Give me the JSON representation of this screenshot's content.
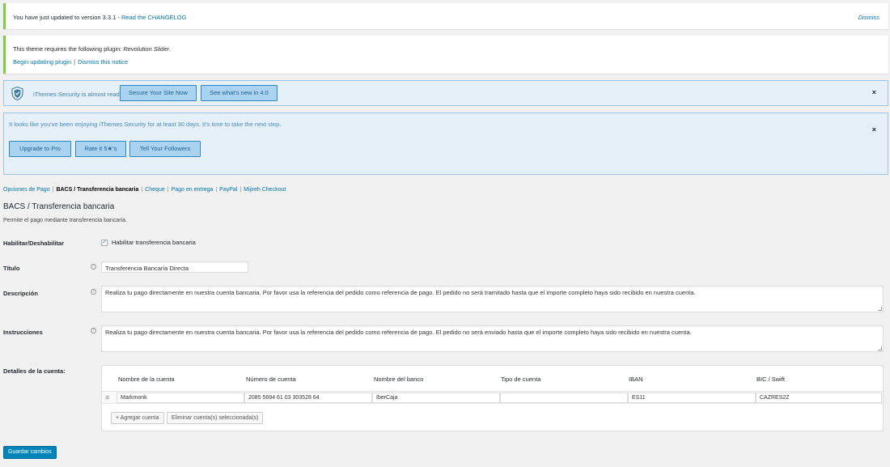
{
  "notice_update": {
    "message": "You have just updated to version 3.3.1 - ",
    "link": "Read the CHANGELOG",
    "dismiss": "Dismiss"
  },
  "notice_plugin": {
    "message_prefix": "This theme requires the following plugin: ",
    "plugin_name": "Revolution Slider",
    "message_suffix": ".",
    "begin_link": "Begin updating plugin",
    "separator": "|",
    "dismiss_link": "Dismiss this notice"
  },
  "ithemes_ready": {
    "message": "iThemes Security is almost ready.",
    "secure_button": "Secure Your Site Now",
    "whats_new_button": "See what's new in 4.0",
    "close": "×"
  },
  "ithemes_enjoy": {
    "message": "It looks like you've been enjoying iThemes Security for at least 30 days. It's time to take the next step.",
    "upgrade_button": "Upgrade to Pro",
    "rate_button": "Rate it 5★'s",
    "followers_button": "Tell Your Followers",
    "close": "×"
  },
  "subnav": {
    "items": [
      "Opciones de Pago",
      "BACS / Transferencia bancaria",
      "Cheque",
      "Pago en entrega",
      "PayPal",
      "Mijireh Checkout"
    ],
    "separator": "|"
  },
  "section": {
    "title": "BACS / Transferencia bancaria",
    "description": "Permite el pago mediante transferencia bancaria."
  },
  "form": {
    "enable_label": "Habilitar/Deshabilitar",
    "enable_checkbox_label": "Habilitar transferencia bancaria",
    "enable_checked": "✓",
    "title_label": "Título",
    "title_value": "Transferencia Bancaria Directa",
    "description_label": "Descripción",
    "description_value": "Realiza tu pago directamente en nuestra cuenta bancaria. Por favor usa la referencia del pedido como referencia de pago. El pedido no será tramitado hasta que el importe completo haya sido recibido en nuestra cuenta.",
    "instructions_label": "Instrucciones",
    "instructions_value": "Realiza tu pago directamente en nuestra cuenta bancaria. Por favor usa la referencia del pedido como referencia de pago. El pedido no será enviado hasta que el importe completo haya sido recibido en nuestra cuenta.",
    "help_icon": "?",
    "account_label": "Detalles de la cuenta:"
  },
  "accounts": {
    "headers": [
      "Nombre de la cuenta",
      "Número de cuenta",
      "Nombre del banco",
      "Tipo de cuenta",
      "IBAN",
      "BIC / Swift"
    ],
    "rows": [
      [
        "Markmonk",
        "2085 5694 61 03 303528 64",
        "IberCaja",
        "",
        "ES11",
        "CAZRES2Z"
      ]
    ],
    "handle_icon": "≡",
    "add_button": "+ Agregar cuenta",
    "remove_button": "Eliminar cuenta(s) seleccionada(s)"
  },
  "save_button": "Guardar cambios",
  "colors": {
    "accent": "#0073aa",
    "notice_border": "#7ad03a",
    "ithemes_bg": "#e5f0f8",
    "save_bg": "#0085ba"
  }
}
